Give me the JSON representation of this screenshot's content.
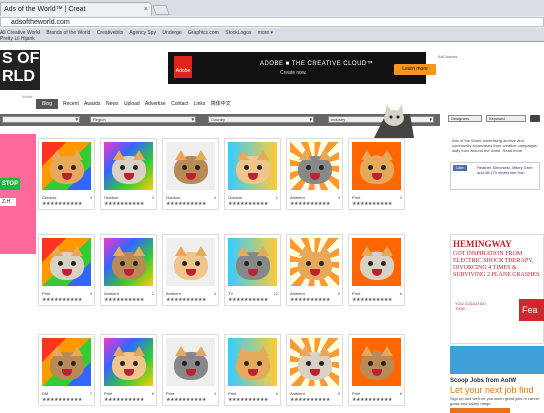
{
  "browser": {
    "tab_title": "Ads of the World™ | Creat",
    "tab_close": "×",
    "url": "adsoftheworld.com",
    "bookmarks": [
      "All Creative World",
      "Brands of the World",
      "Creativebits",
      "Agency Spy",
      "Underge",
      "Graphics.com",
      "StockLogos",
      "more ▾"
    ],
    "bookmark_row2": "Pretty Lil Hijank"
  },
  "site": {
    "logo_lines": [
      "S OF",
      "RLD"
    ],
    "logo_small": "World",
    "top_ad": {
      "brand": "Adobe",
      "title": "ADOBE ■ THE CREATIVE CLOUD™",
      "subtitle": "Create now.",
      "button": "Learn more",
      "more": "AdChoices"
    },
    "nav": {
      "blog": "Blog",
      "links": [
        "Recent",
        "Awards",
        "News",
        "Upload",
        "Advertise",
        "Contact",
        "Links",
        "简体中文"
      ]
    },
    "filters": {
      "f1": "",
      "f2": "Region",
      "f3": "Country",
      "f4": "Industry",
      "search_type": "Designers",
      "search_field": "Keyword"
    },
    "left_promo": {
      "stop": "STOP",
      "lang": "Z.H"
    },
    "cards": [
      {
        "label": "Outdoor",
        "num": "3",
        "stars": "★★★★★★★★★★"
      },
      {
        "label": "Outdoor",
        "num": "3",
        "stars": "★★★★★★★★★★"
      },
      {
        "label": "Outdoor",
        "num": "4",
        "stars": "★★★★★★★★★★"
      },
      {
        "label": "Outdoor",
        "num": "1",
        "stars": "★★★★★★★★★★"
      },
      {
        "label": "Ambient",
        "num": "3",
        "stars": "★★★★★★★★★★"
      },
      {
        "label": "Print",
        "num": "3",
        "stars": "★★★★★★★★★★"
      },
      {
        "label": "Print",
        "num": "4",
        "stars": "★★★★★★★★★★"
      },
      {
        "label": "Ambient",
        "num": "2",
        "stars": "★★★★★★★★★★"
      },
      {
        "label": "Ambient",
        "num": "3",
        "stars": "★★★★★★★★★★"
      },
      {
        "label": "TV",
        "num": "12",
        "stars": "★★★★★★★★★★"
      },
      {
        "label": "Ambient",
        "num": "5",
        "stars": "★★★★★★★★★★"
      },
      {
        "label": "Print",
        "num": "6",
        "stars": "★★★★★★★★★★"
      },
      {
        "label": "DM",
        "num": "7",
        "stars": "★★★★★★★★★★"
      },
      {
        "label": "Print",
        "num": "6",
        "stars": "★★★★★★★★★★"
      },
      {
        "label": "Print",
        "num": "4",
        "stars": "★★★★★★★★★★"
      },
      {
        "label": "Print",
        "num": "6",
        "stars": "★★★★★★★★★★"
      },
      {
        "label": "Ambient",
        "num": "5",
        "stars": "★★★★★★★★★★"
      },
      {
        "label": "Print",
        "num": "6",
        "stars": "★★★★★★★★★★"
      }
    ],
    "right": {
      "about": "Ads of the World advertising archive and community showcases from creative campaigns daily from around the world. Read more",
      "fb_like": "Like",
      "fb_text": "Heather Simonielo, Mikey Gree and 48,170 others like this.",
      "hem_title": "HEMINGWAY",
      "hem_sub": "GOT INSPIRATION FROM ELECTRIC SHOCK THERAPY, DIVORCING 4 TIMES & SURVIVING 2 PLANE CRASHES",
      "hem_q": "YOU COULD DO THAT...",
      "hem_btn": "Fea",
      "jobs_heading": "Scoop Jobs from AotW",
      "jobs_title": "Let your next job find",
      "jobs_desc": "Sign up and we'll let you when great jobs m career goals and salary range."
    }
  }
}
